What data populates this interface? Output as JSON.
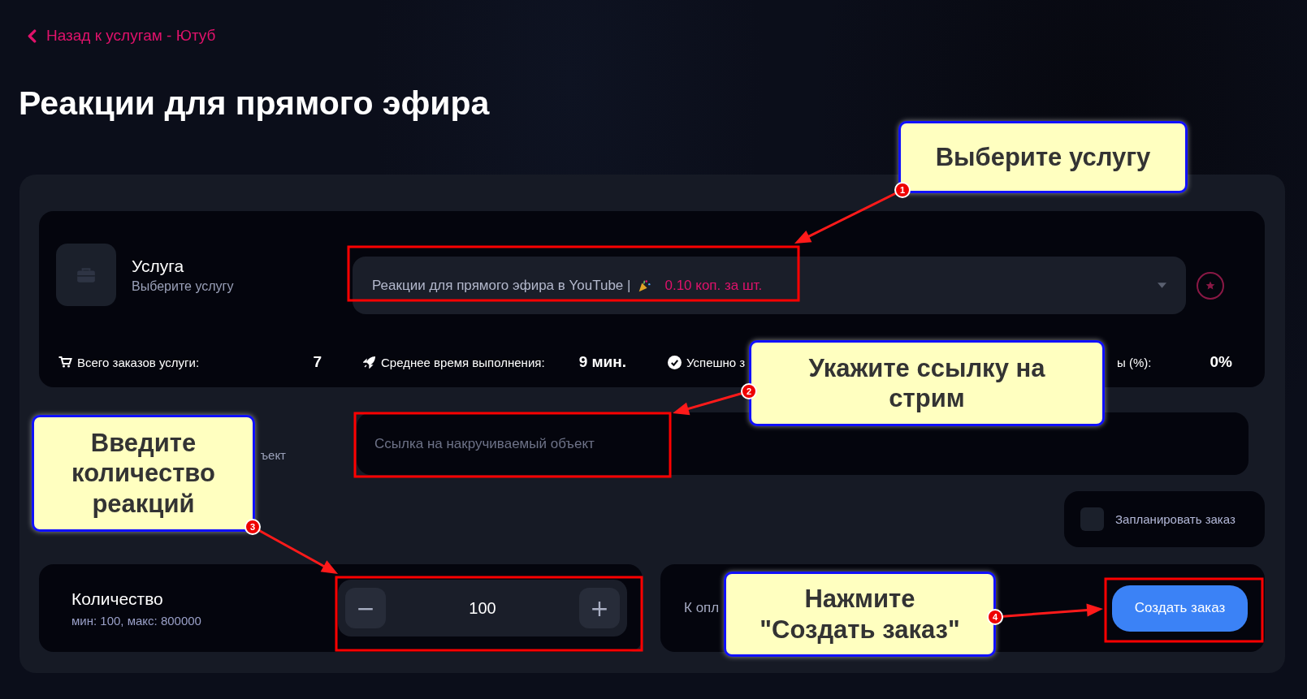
{
  "back_link": {
    "text": "Назад к услугам - Ютуб"
  },
  "title": "Реакции для прямого эфира",
  "service": {
    "label": "Услуга",
    "hint": "Выберите услугу",
    "select_text": "Реакции для прямого эфира в YouTube |",
    "price": "0.10 коп. за шт."
  },
  "stats": [
    {
      "kind": "cart",
      "label": "Всего заказов услуги:",
      "value": "7"
    },
    {
      "kind": "rocket",
      "label": "Среднее время выполнения:",
      "value": "9 мин."
    },
    {
      "kind": "check",
      "label": "Успешно з"
    },
    {
      "kind": "plain",
      "label": "ы (%):",
      "value": "0%"
    }
  ],
  "link": {
    "label": "ъект",
    "placeholder": "Ссылка на накручиваемый объект"
  },
  "schedule": {
    "label": "Запланировать заказ",
    "checked": false
  },
  "quantity": {
    "label": "Количество",
    "hint": "мин: 100, макс: 800000",
    "value": "100",
    "minus": "−",
    "plus": "+"
  },
  "payment": {
    "label": "К опл",
    "button": "Создать заказ"
  },
  "annotations": [
    {
      "number": "1",
      "text": "Выберите услугу"
    },
    {
      "number": "2",
      "text": "Укажите ссылку на стрим"
    },
    {
      "number": "3",
      "text": "Введите количество реакций"
    },
    {
      "number": "4",
      "text": "Нажмите \"Создать заказ\""
    }
  ]
}
